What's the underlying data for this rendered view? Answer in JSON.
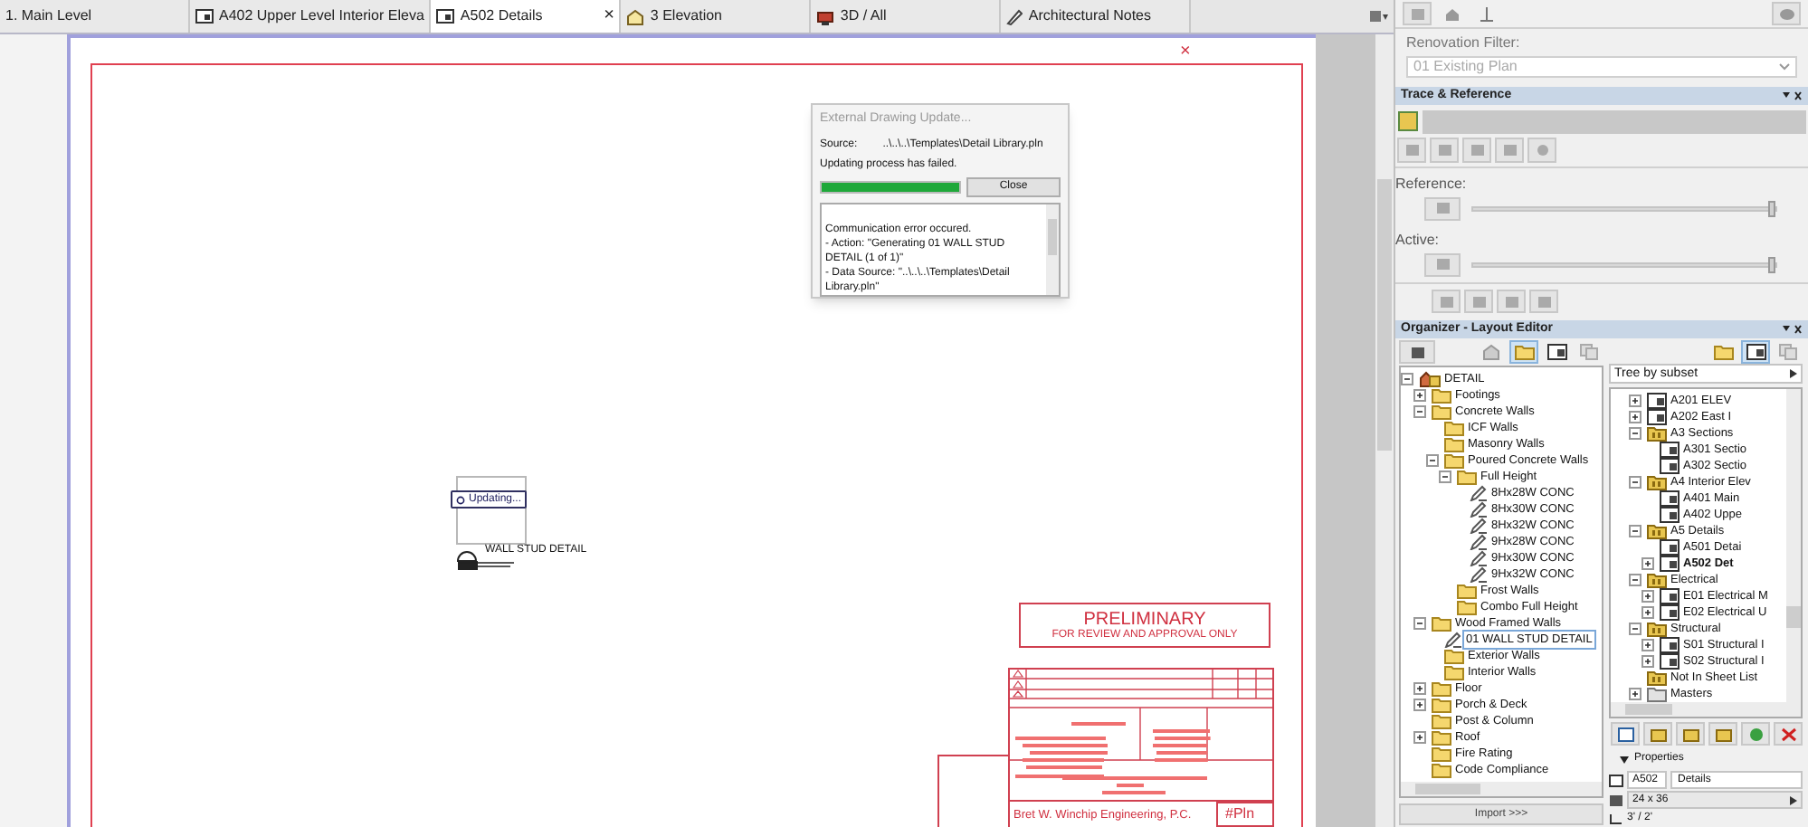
{
  "tabs": [
    {
      "label": "1. Main Level",
      "kind": "plan",
      "selected": false
    },
    {
      "label": "A402 Upper Level Interior Eleva",
      "kind": "layout",
      "selected": false
    },
    {
      "label": "A502 Details",
      "kind": "layout",
      "selected": true,
      "close": "×"
    },
    {
      "label": "3 Elevation",
      "kind": "elevation",
      "selected": false
    },
    {
      "label": "3D / All",
      "kind": "camera",
      "selected": false
    },
    {
      "label": "Architectural Notes",
      "kind": "notes",
      "selected": false
    }
  ],
  "sheet": {
    "close_mark": "×",
    "updating_badge": "Updating...",
    "detail_label": "WALL STUD DETAIL",
    "stamp": {
      "title": "PRELIMINARY",
      "subtitle": "FOR REVIEW AND APPROVAL ONLY"
    },
    "firm": "Bret W. Winchip Engineering, P.C.",
    "sheet_ref": "#Pln"
  },
  "dialog": {
    "title": "External Drawing Update...",
    "source_label": "Source:",
    "source_value": "..\\..\\..\\Templates\\Detail Library.pln",
    "status": "Updating process has failed.",
    "progress": {
      "level": 1
    },
    "close_button": "Close",
    "log": [
      "Communication error occured.",
      "- Action: \"Generating 01 WALL STUD DETAIL (1 of 1)\"",
      "- Data Source: \"..\\..\\..\\Templates\\Detail Library.pln\""
    ]
  },
  "renovation": {
    "label": "Renovation Filter:",
    "value": "01 Existing Plan"
  },
  "trace": {
    "title": "Trace & Reference",
    "reference_label": "Reference:",
    "reference": {
      "level": 1
    },
    "active_label": "Active:",
    "active": {
      "level": 1
    }
  },
  "organizer": {
    "title": "Organizer - Layout Editor",
    "left_view_buttons": [
      {
        "kind": "house",
        "selected": false
      },
      {
        "kind": "folder",
        "selected": true
      },
      {
        "kind": "sheet",
        "selected": false
      },
      {
        "kind": "copy",
        "selected": false
      }
    ],
    "detail_tree": [
      {
        "label": "DETAIL",
        "kind": "root",
        "expanded": true,
        "children": [
          {
            "label": "Footings",
            "kind": "folder",
            "expanded": false
          },
          {
            "label": "Concrete Walls",
            "kind": "folder",
            "expanded": true,
            "children": [
              {
                "label": "ICF Walls",
                "kind": "folder"
              },
              {
                "label": "Masonry Walls",
                "kind": "folder"
              },
              {
                "label": "Poured Concrete Walls",
                "kind": "folder",
                "expanded": true,
                "children": [
                  {
                    "label": "Full Height",
                    "kind": "folder",
                    "expanded": true,
                    "children": [
                      {
                        "label": "8Hx28W CONC",
                        "kind": "detail"
                      },
                      {
                        "label": "8Hx30W CONC",
                        "kind": "detail"
                      },
                      {
                        "label": "8Hx32W CONC",
                        "kind": "detail"
                      },
                      {
                        "label": "9Hx28W CONC",
                        "kind": "detail"
                      },
                      {
                        "label": "9Hx30W CONC",
                        "kind": "detail"
                      },
                      {
                        "label": "9Hx32W CONC",
                        "kind": "detail"
                      }
                    ]
                  },
                  {
                    "label": "Frost Walls",
                    "kind": "folder"
                  },
                  {
                    "label": "Combo Full Height",
                    "kind": "folder"
                  }
                ]
              }
            ]
          },
          {
            "label": "Wood Framed Walls",
            "kind": "folder",
            "expanded": true,
            "children": [
              {
                "label": "01 WALL STUD DETAIL",
                "kind": "detail",
                "selected": true
              },
              {
                "label": "Exterior Walls",
                "kind": "folder"
              },
              {
                "label": "Interior Walls",
                "kind": "folder"
              }
            ]
          },
          {
            "label": "Floor",
            "kind": "folder",
            "expanded": false
          },
          {
            "label": "Porch & Deck",
            "kind": "folder",
            "expanded": false
          },
          {
            "label": "Post & Column",
            "kind": "folder"
          },
          {
            "label": "Roof",
            "kind": "folder",
            "expanded": false
          },
          {
            "label": "Fire Rating",
            "kind": "folder"
          },
          {
            "label": "Code Compliance",
            "kind": "folder"
          }
        ]
      }
    ],
    "import_button": "Import >>>",
    "right_view_buttons": [
      {
        "kind": "folder",
        "selected": false
      },
      {
        "kind": "sheet",
        "selected": true
      },
      {
        "kind": "copy",
        "selected": false
      }
    ],
    "subset_dropdown": "Tree by subset",
    "sheet_tree": [
      {
        "label": "A201 ELEV",
        "kind": "sheet",
        "expanded": false
      },
      {
        "label": "A202 East I",
        "kind": "sheet",
        "expanded": false
      },
      {
        "label": "A3 Sections",
        "kind": "subset",
        "expanded": true,
        "children": [
          {
            "label": "A301 Sectio",
            "kind": "sheet"
          },
          {
            "label": "A302 Sectio",
            "kind": "sheet"
          }
        ]
      },
      {
        "label": "A4 Interior Elev",
        "kind": "subset",
        "expanded": true,
        "children": [
          {
            "label": "A401 Main",
            "kind": "sheet"
          },
          {
            "label": "A402 Uppe",
            "kind": "sheet"
          }
        ]
      },
      {
        "label": "A5 Details",
        "kind": "subset",
        "expanded": true,
        "children": [
          {
            "label": "A501 Detai",
            "kind": "sheet"
          },
          {
            "label": "A502 Det",
            "kind": "sheet",
            "expanded": false,
            "selected": true
          }
        ]
      },
      {
        "label": "Electrical",
        "kind": "subset",
        "expanded": true,
        "children": [
          {
            "label": "E01 Electrical M",
            "kind": "sheet",
            "expanded": false
          },
          {
            "label": "E02 Electrical U",
            "kind": "sheet",
            "expanded": false
          }
        ]
      },
      {
        "label": "Structural",
        "kind": "subset",
        "expanded": true,
        "children": [
          {
            "label": "S01 Structural I",
            "kind": "sheet",
            "expanded": false
          },
          {
            "label": "S02 Structural I",
            "kind": "sheet",
            "expanded": false
          }
        ]
      },
      {
        "label": "Not In Sheet List",
        "kind": "subset"
      },
      {
        "label": "Masters",
        "kind": "masters",
        "expanded": false
      }
    ],
    "properties": {
      "title": "Properties",
      "number": "A502",
      "name": "Details",
      "size": "24 x 36",
      "scale": "3' / 2'"
    }
  }
}
